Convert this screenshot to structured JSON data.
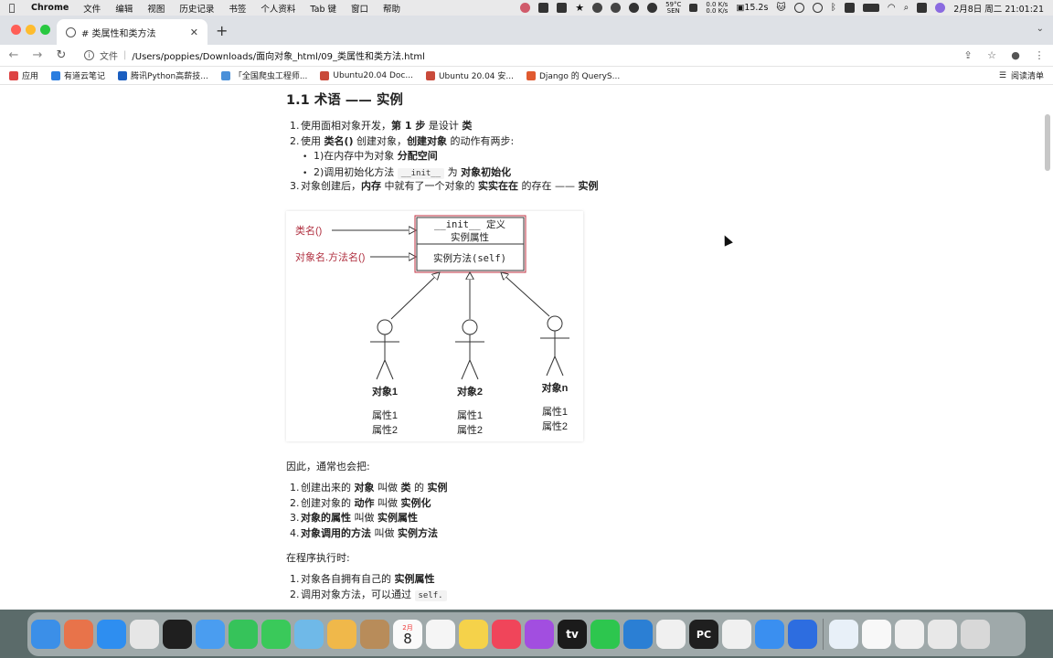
{
  "menubar": {
    "app": "Chrome",
    "items": [
      "文件",
      "编辑",
      "视图",
      "历史记录",
      "书签",
      "个人资料",
      "Tab 键",
      "窗口",
      "帮助"
    ],
    "weather_temp": "59°C",
    "weather_unit": "SEN",
    "net_up": "0.0 K/s",
    "net_down": "0.0 K/s",
    "timer": "15.2s",
    "datetime": "2月8日 周二  21:01:21"
  },
  "browser": {
    "tab_title": "# 类属性和类方法",
    "url_scheme": "文件",
    "url": "/Users/poppies/Downloads/面向对象_html/09_类属性和类方法.html",
    "bookmarks": [
      "应用",
      "有道云笔记",
      "腾讯Python高薪技...",
      "「全国爬虫工程师...",
      "Ubuntu20.04 Doc...",
      "Ubuntu 20.04 安...",
      "Django 的 QueryS..."
    ],
    "reading_list": "阅读清单"
  },
  "doc": {
    "heading": "1.1 术语 —— 实例",
    "list1": [
      {
        "num": "1.",
        "parts": [
          [
            "使用面相对象开发，",
            false
          ],
          [
            "第 1 步",
            true
          ],
          [
            " 是设计 ",
            false
          ],
          [
            "类",
            true
          ]
        ]
      },
      {
        "num": "2.",
        "parts": [
          [
            "使用 ",
            false
          ],
          [
            "类名()",
            true
          ],
          [
            " 创建对象，",
            false
          ],
          [
            "创建对象",
            true
          ],
          [
            " 的动作有两步:",
            false
          ]
        ]
      }
    ],
    "sublist": [
      {
        "num": "1)",
        "parts": [
          [
            "在内存中为对象 ",
            false
          ],
          [
            "分配空间",
            true
          ]
        ]
      },
      {
        "num": "2)",
        "parts": [
          [
            "调用初始化方法 ",
            false
          ],
          [
            "__init__",
            "code"
          ],
          [
            " 为 ",
            false
          ],
          [
            "对象初始化",
            true
          ]
        ]
      }
    ],
    "list1_item3": {
      "num": "3.",
      "parts": [
        [
          "对象创建后，",
          false
        ],
        [
          "内存",
          true
        ],
        [
          " 中就有了一个对象的 ",
          false
        ],
        [
          "实实在在",
          true
        ],
        [
          " 的存在 —— ",
          false
        ],
        [
          "实例",
          true
        ]
      ]
    },
    "diagram": {
      "label_classname": "类名()",
      "label_method_call": "对象名.方法名()",
      "box_init_line1": "__init__ 定义",
      "box_init_line2": "实例属性",
      "box_method": "实例方法(self)",
      "objects": [
        {
          "name": "对象1",
          "attr1": "属性1",
          "attr2": "属性2"
        },
        {
          "name": "对象2",
          "attr1": "属性1",
          "attr2": "属性2"
        },
        {
          "name": "对象n",
          "attr1": "属性1",
          "attr2": "属性2"
        }
      ]
    },
    "para1": "因此，通常也会把:",
    "list2": [
      {
        "num": "1.",
        "parts": [
          [
            "创建出来的 ",
            false
          ],
          [
            "对象",
            true
          ],
          [
            " 叫做 ",
            false
          ],
          [
            "类",
            true
          ],
          [
            " 的 ",
            false
          ],
          [
            "实例",
            true
          ]
        ]
      },
      {
        "num": "2.",
        "parts": [
          [
            "创建对象的 ",
            false
          ],
          [
            "动作",
            true
          ],
          [
            " 叫做 ",
            false
          ],
          [
            "实例化",
            true
          ]
        ]
      },
      {
        "num": "3.",
        "parts": [
          [
            "对象的属性",
            true
          ],
          [
            " 叫做 ",
            false
          ],
          [
            "实例属性",
            true
          ]
        ]
      },
      {
        "num": "4.",
        "parts": [
          [
            "对象调用的方法",
            true
          ],
          [
            " 叫做 ",
            false
          ],
          [
            "实例方法",
            true
          ]
        ]
      }
    ],
    "para2": "在程序执行时:",
    "list3": [
      {
        "num": "1.",
        "parts": [
          [
            "对象各自拥有自己的 ",
            false
          ],
          [
            "实例属性",
            true
          ]
        ]
      },
      {
        "num": "2.",
        "parts": [
          [
            "调用对象方法，可以通过 ",
            false
          ],
          [
            "self.",
            "code"
          ]
        ]
      }
    ]
  },
  "dock": {
    "icons": [
      {
        "name": "finder-icon",
        "color": "#3b8fe8"
      },
      {
        "name": "launchpad-icon",
        "color": "#e8734a"
      },
      {
        "name": "safari-icon",
        "color": "#2e8ef0"
      },
      {
        "name": "chrome-icon",
        "color": "#e6e6e6"
      },
      {
        "name": "terminal-icon",
        "color": "#1f1f1f"
      },
      {
        "name": "mail-icon",
        "color": "#4a9df0"
      },
      {
        "name": "facetime-icon",
        "color": "#36c35a"
      },
      {
        "name": "messages-icon",
        "color": "#3ac95a"
      },
      {
        "name": "maps-icon",
        "color": "#6fb9e8"
      },
      {
        "name": "photos-icon",
        "color": "#f0b84a"
      },
      {
        "name": "contacts-icon",
        "color": "#b88c5a"
      },
      {
        "name": "calendar-icon",
        "color": "#fafafa"
      },
      {
        "name": "reminders-icon",
        "color": "#f5f5f5"
      },
      {
        "name": "notes-icon",
        "color": "#f5d24a"
      },
      {
        "name": "music-icon",
        "color": "#f0455a"
      },
      {
        "name": "podcasts-icon",
        "color": "#a24ee0"
      },
      {
        "name": "tv-icon",
        "color": "#1b1b1b"
      },
      {
        "name": "wechat-icon",
        "color": "#2dc64e"
      },
      {
        "name": "vscode-icon",
        "color": "#2b7fd4"
      },
      {
        "name": "qq-icon",
        "color": "#f0f0f0"
      },
      {
        "name": "pycharm-icon",
        "color": "#1f1f1f"
      },
      {
        "name": "baidu-netdisk-icon",
        "color": "#f0f0f0"
      },
      {
        "name": "qq-browser-icon",
        "color": "#3a8ff0"
      },
      {
        "name": "screen-recorder-icon",
        "color": "#2d6de0"
      },
      {
        "name": "stocks-icon",
        "color": "#e8f0f8"
      },
      {
        "name": "document-icon",
        "color": "#f8f8f8"
      },
      {
        "name": "preview-icon",
        "color": "#f0f0f0"
      },
      {
        "name": "file-window-icon",
        "color": "#e8e8e8"
      },
      {
        "name": "trash-icon",
        "color": "#d8d8d8"
      }
    ],
    "calendar_month": "2月",
    "calendar_day": "8",
    "tv_label": "tv",
    "pycharm_label": "PC"
  }
}
